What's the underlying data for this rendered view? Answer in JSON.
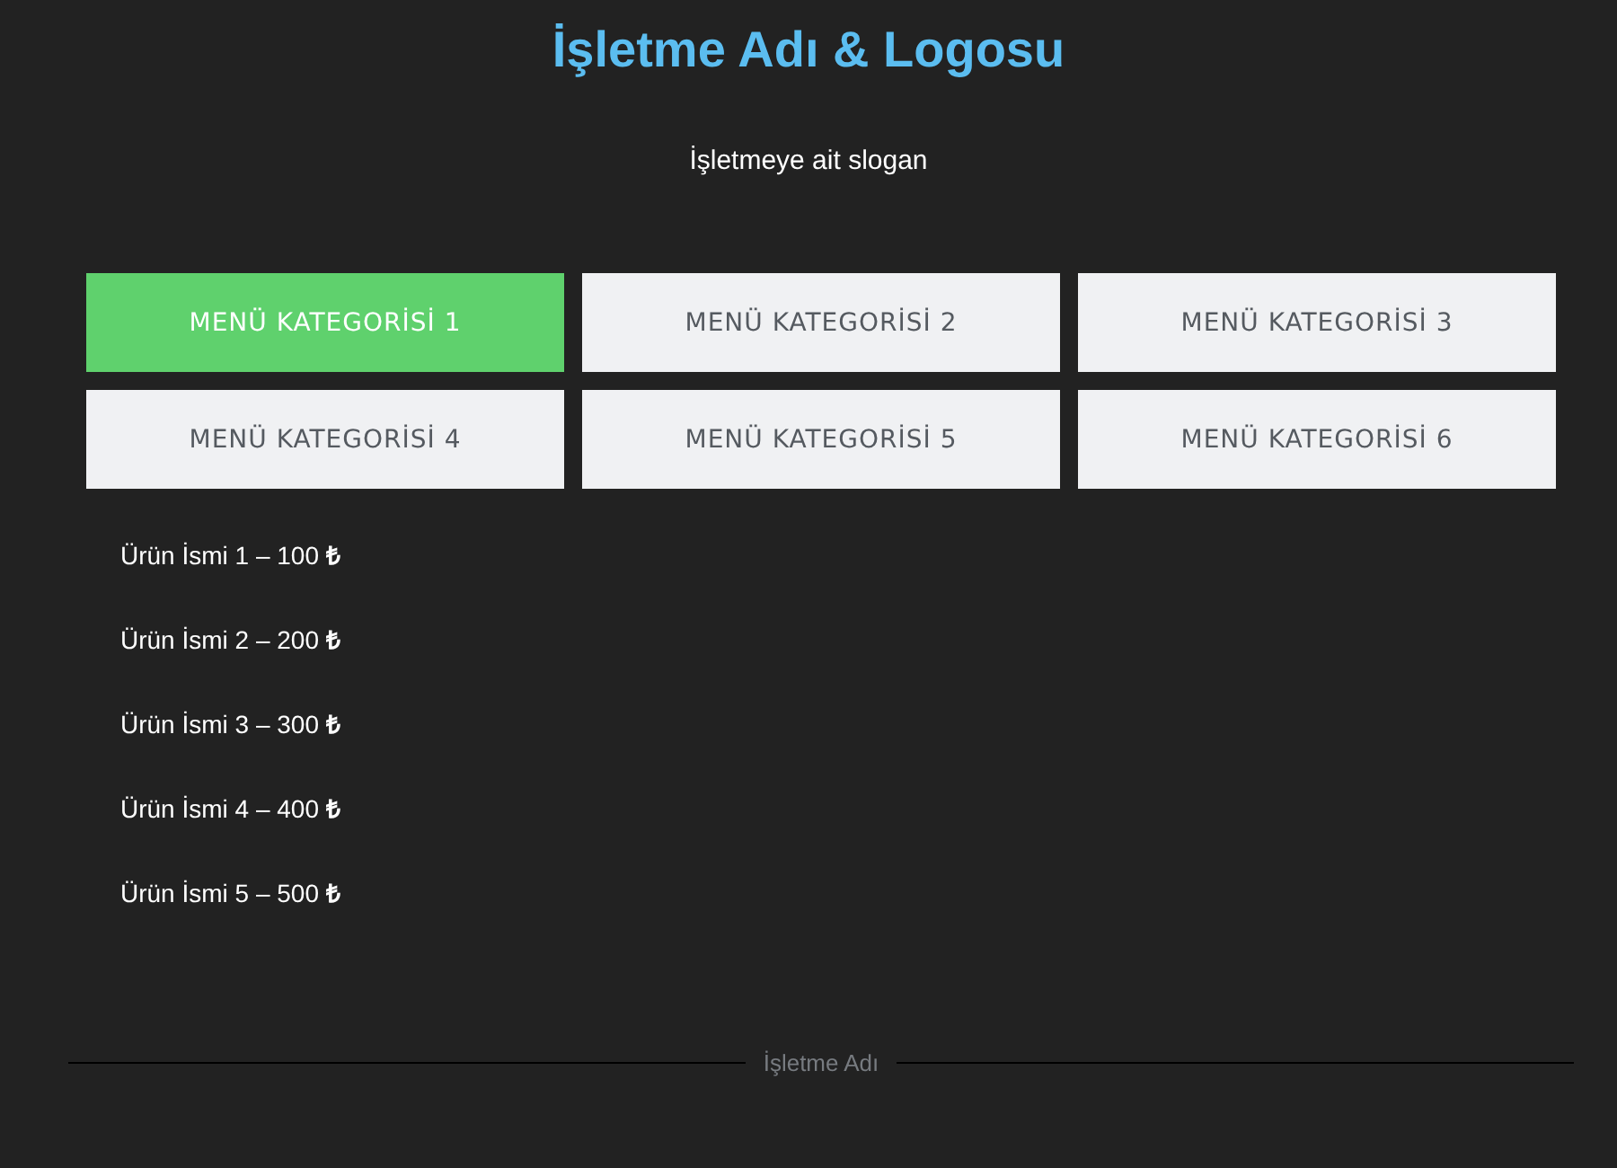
{
  "header": {
    "title": "İşletme Adı & Logosu",
    "slogan": "İşletmeye ait slogan"
  },
  "categories": [
    {
      "label": "MENÜ KATEGORİSİ 1",
      "selected": true
    },
    {
      "label": "MENÜ KATEGORİSİ 2",
      "selected": false
    },
    {
      "label": "MENÜ KATEGORİSİ 3",
      "selected": false
    },
    {
      "label": "MENÜ KATEGORİSİ 4",
      "selected": false
    },
    {
      "label": "MENÜ KATEGORİSİ 5",
      "selected": false
    },
    {
      "label": "MENÜ KATEGORİSİ 6",
      "selected": false
    }
  ],
  "products": [
    "Ürün İsmi 1 – 100 **₺**",
    "Ürün İsmi 2 – 200 **₺**",
    "Ürün İsmi 3 – 300 **₺**",
    "Ürün İsmi 4 – 400 **₺**",
    "Ürün İsmi 5 – 500 **₺**"
  ],
  "footer": {
    "text": "İşletme Adı"
  }
}
